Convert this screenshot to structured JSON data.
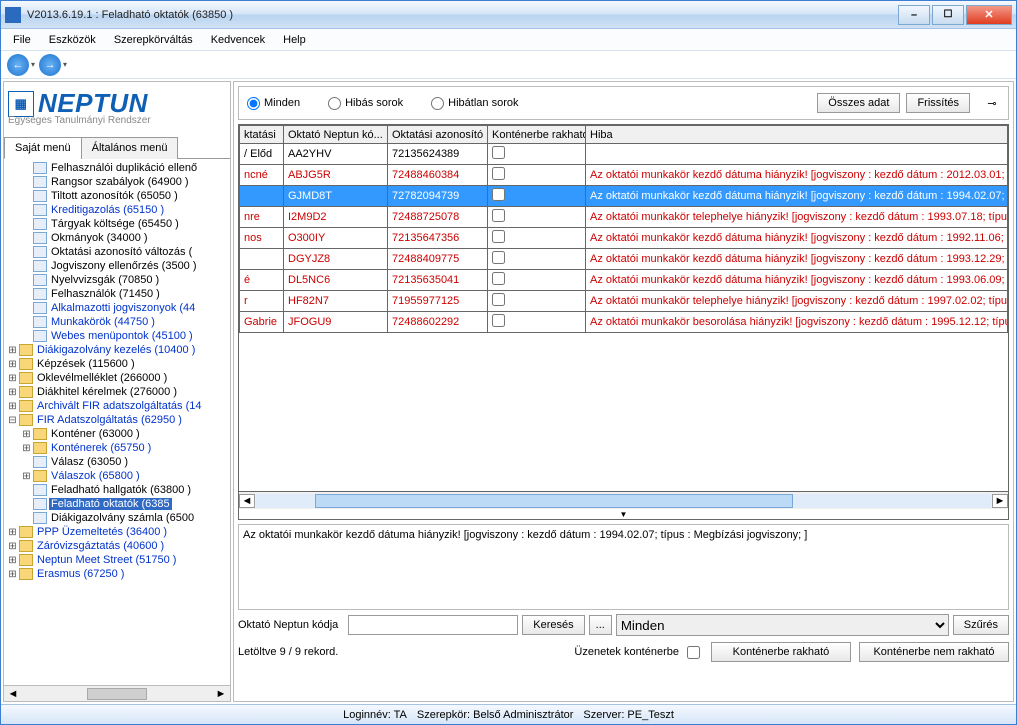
{
  "window": {
    "title": "V2013.6.19.1 : Feladható oktatók (63850  )"
  },
  "menubar": {
    "items": [
      "File",
      "Eszközök",
      "Szerepkörváltás",
      "Kedvencek",
      "Help"
    ]
  },
  "logo": {
    "name": "NEPTUN",
    "sub": "Egységes Tanulmányi Rendszer"
  },
  "tabs": {
    "a": "Saját menü",
    "b": "Általános menü"
  },
  "tree": [
    {
      "lvl": 1,
      "exp": "",
      "icon": "leaf",
      "label": "Felhasználói duplikáció ellenő",
      "link": false
    },
    {
      "lvl": 1,
      "exp": "",
      "icon": "leaf",
      "label": "Rangsor szabályok (64900  )",
      "link": false
    },
    {
      "lvl": 1,
      "exp": "",
      "icon": "leaf",
      "label": "Tiltott azonosítók (65050  )",
      "link": false
    },
    {
      "lvl": 1,
      "exp": "",
      "icon": "leaf",
      "label": "Kreditigazolás (65150  )",
      "link": true
    },
    {
      "lvl": 1,
      "exp": "",
      "icon": "leaf",
      "label": "Tárgyak költsége (65450  )",
      "link": false
    },
    {
      "lvl": 1,
      "exp": "",
      "icon": "leaf",
      "label": "Okmányok (34000  )",
      "link": false
    },
    {
      "lvl": 1,
      "exp": "",
      "icon": "leaf",
      "label": "Oktatási azonosító változás (",
      "link": false
    },
    {
      "lvl": 1,
      "exp": "",
      "icon": "leaf",
      "label": "Jogviszony ellenőrzés (3500  )",
      "link": false
    },
    {
      "lvl": 1,
      "exp": "",
      "icon": "leaf",
      "label": "Nyelvvizsgák (70850  )",
      "link": false
    },
    {
      "lvl": 1,
      "exp": "",
      "icon": "leaf",
      "label": "Felhasználók (71450  )",
      "link": false
    },
    {
      "lvl": 1,
      "exp": "",
      "icon": "leaf",
      "label": "Alkalmazotti jogviszonyok (44",
      "link": true
    },
    {
      "lvl": 1,
      "exp": "",
      "icon": "leaf",
      "label": "Munkakörök (44750  )",
      "link": true
    },
    {
      "lvl": 1,
      "exp": "",
      "icon": "leaf",
      "label": "Webes menüpontok (45100  )",
      "link": true
    },
    {
      "lvl": 0,
      "exp": "plus",
      "icon": "folder",
      "label": "Diákigazolvány kezelés (10400  )",
      "link": true
    },
    {
      "lvl": 0,
      "exp": "plus",
      "icon": "folder",
      "label": "Képzések (115600  )",
      "link": false
    },
    {
      "lvl": 0,
      "exp": "plus",
      "icon": "folder",
      "label": "Oklevélmelléklet (266000  )",
      "link": false
    },
    {
      "lvl": 0,
      "exp": "plus",
      "icon": "folder",
      "label": "Diákhitel kérelmek (276000  )",
      "link": false
    },
    {
      "lvl": 0,
      "exp": "plus",
      "icon": "folder",
      "label": "Archivált FIR adatszolgáltatás (14",
      "link": true
    },
    {
      "lvl": 0,
      "exp": "minus",
      "icon": "folder",
      "label": "FIR Adatszolgáltatás (62950  )",
      "link": true
    },
    {
      "lvl": 1,
      "exp": "plus",
      "icon": "folder",
      "label": "Konténer (63000  )",
      "link": false
    },
    {
      "lvl": 1,
      "exp": "plus",
      "icon": "folder",
      "label": "Konténerek (65750  )",
      "link": true
    },
    {
      "lvl": 1,
      "exp": "",
      "icon": "leaf",
      "label": "Válasz (63050  )",
      "link": false
    },
    {
      "lvl": 1,
      "exp": "plus",
      "icon": "folder",
      "label": "Válaszok (65800  )",
      "link": true
    },
    {
      "lvl": 1,
      "exp": "",
      "icon": "leaf",
      "label": "Feladható hallgatók (63800  )",
      "link": false
    },
    {
      "lvl": 1,
      "exp": "",
      "icon": "leaf",
      "label": "Feladható oktatók (6385",
      "link": false,
      "sel": true
    },
    {
      "lvl": 1,
      "exp": "",
      "icon": "leaf",
      "label": "Diákigazolvány számla (6500",
      "link": false
    },
    {
      "lvl": 0,
      "exp": "plus",
      "icon": "folder",
      "label": "PPP Üzemeltetés (36400  )",
      "link": true
    },
    {
      "lvl": 0,
      "exp": "plus",
      "icon": "folder",
      "label": "Záróvizsgáztatás (40600  )",
      "link": true
    },
    {
      "lvl": 0,
      "exp": "plus",
      "icon": "folder",
      "label": "Neptun Meet Street (51750  )",
      "link": true
    },
    {
      "lvl": 0,
      "exp": "plus",
      "icon": "folder",
      "label": "Erasmus (67250  )",
      "link": true
    }
  ],
  "filter": {
    "all": "Minden",
    "err": "Hibás sorok",
    "ok": "Hibátlan sorok",
    "all_data_btn": "Összes adat",
    "refresh_btn": "Frissítés"
  },
  "grid": {
    "cols": [
      "ktatási",
      "Oktató Neptun kó...",
      "Oktatási azonosító",
      "Konténerbe rakható",
      "Hiba"
    ],
    "rows": [
      {
        "c": [
          "/ Előd",
          "AA2YHV",
          "72135624389",
          "",
          ""
        ],
        "err": false,
        "sel": false
      },
      {
        "c": [
          "ncné",
          "ABJG5R",
          "72488460384",
          "",
          "Az oktatói munkakör kezdő dátuma hiányzik! [jogviszony : kezdő dátum : 2012.03.01; t"
        ],
        "err": true,
        "sel": false
      },
      {
        "c": [
          "",
          "GJMD8T",
          "72782094739",
          "",
          "Az oktatói munkakör kezdő dátuma hiányzik! [jogviszony : kezdő dátum : 1994.02.07; t"
        ],
        "err": true,
        "sel": true
      },
      {
        "c": [
          "nre",
          "I2M9D2",
          "72488725078",
          "",
          "Az oktatói munkakör telephelye hiányzik! [jogviszony : kezdő dátum : 1993.07.18; típus"
        ],
        "err": true,
        "sel": false
      },
      {
        "c": [
          "nos",
          "O300IY",
          "72135647356",
          "",
          "Az oktatói munkakör kezdő dátuma hiányzik! [jogviszony : kezdő dátum : 1992.11.06;"
        ],
        "err": true,
        "sel": false
      },
      {
        "c": [
          "",
          "DGYJZ8",
          "72488409775",
          "",
          "Az oktatói munkakör kezdő dátuma hiányzik! [jogviszony : kezdő dátum : 1993.12.29; t"
        ],
        "err": true,
        "sel": false
      },
      {
        "c": [
          "é",
          "DL5NC6",
          "72135635041",
          "",
          "Az oktatói munkakör kezdő dátuma hiányzik! [jogviszony : kezdő dátum : 1993.06.09; t"
        ],
        "err": true,
        "sel": false
      },
      {
        "c": [
          "r",
          "HF82N7",
          "71955977125",
          "",
          "Az oktatói munkakör telephelye hiányzik! [jogviszony : kezdő dátum : 1997.02.02; típus"
        ],
        "err": true,
        "sel": false
      },
      {
        "c": [
          "Gabrie",
          "JFOGU9",
          "72488602292",
          "",
          "Az oktatói munkakör besorolása hiányzik! [jogviszony : kezdő dátum : 1995.12.12; típu"
        ],
        "err": true,
        "sel": false
      }
    ]
  },
  "detail": "Az oktatói munkakör kezdő dátuma hiányzik! [jogviszony : kezdő dátum : 1994.02.07; típus : Megbízási jogviszony; ]",
  "search": {
    "label": "Oktató Neptun kódja",
    "search_btn": "Keresés",
    "browse_btn": "...",
    "dropdown": "Minden",
    "filter_btn": "Szűrés"
  },
  "bottom": {
    "count": "Letöltve 9 / 9 rekord.",
    "konteiner_chk": "Üzenetek konténerbe",
    "btn1": "Konténerbe rakható",
    "btn2": "Konténerbe nem rakható"
  },
  "status": {
    "login": "Loginnév: TA",
    "role": "Szerepkör: Belső Adminisztrátor",
    "server": "Szerver: PE_Teszt"
  }
}
